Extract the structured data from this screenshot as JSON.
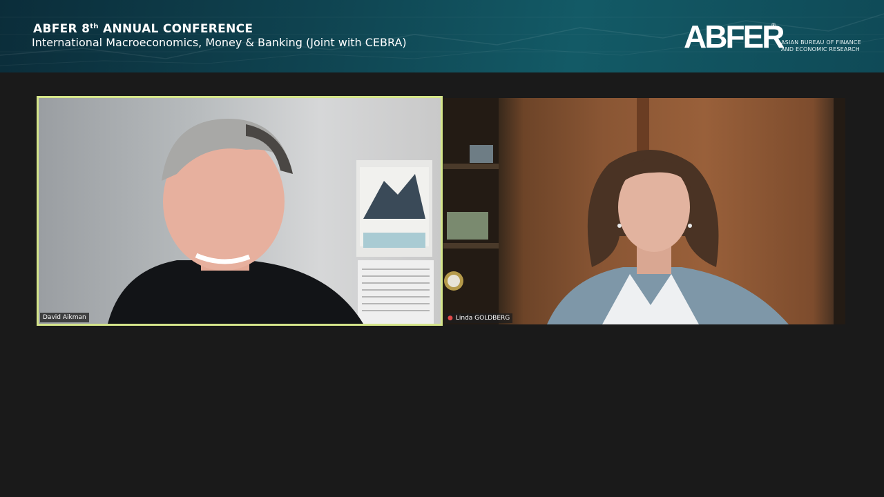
{
  "banner": {
    "title_prefix": "ABFER 8",
    "title_sup": "th",
    "title_suffix": " ANNUAL CONFERENCE",
    "subtitle": "International Macroeconomics, Money & Banking (Joint with CEBRA)",
    "logo_mark": "ABFER",
    "logo_reg": "®",
    "logo_line1": "ASIAN BUREAU OF FINANCE",
    "logo_line2": "AND ECONOMIC RESEARCH"
  },
  "participants": [
    {
      "name": "David Aikman",
      "active_speaker": true,
      "muted": false
    },
    {
      "name": "Linda GOLDBERG",
      "active_speaker": false,
      "muted": true
    }
  ],
  "colors": {
    "background": "#1a1a1a",
    "active_speaker_border": "#d5e58a",
    "muted_icon": "#e04a4a"
  },
  "icons": {
    "muted": "microphone-muted-icon"
  }
}
